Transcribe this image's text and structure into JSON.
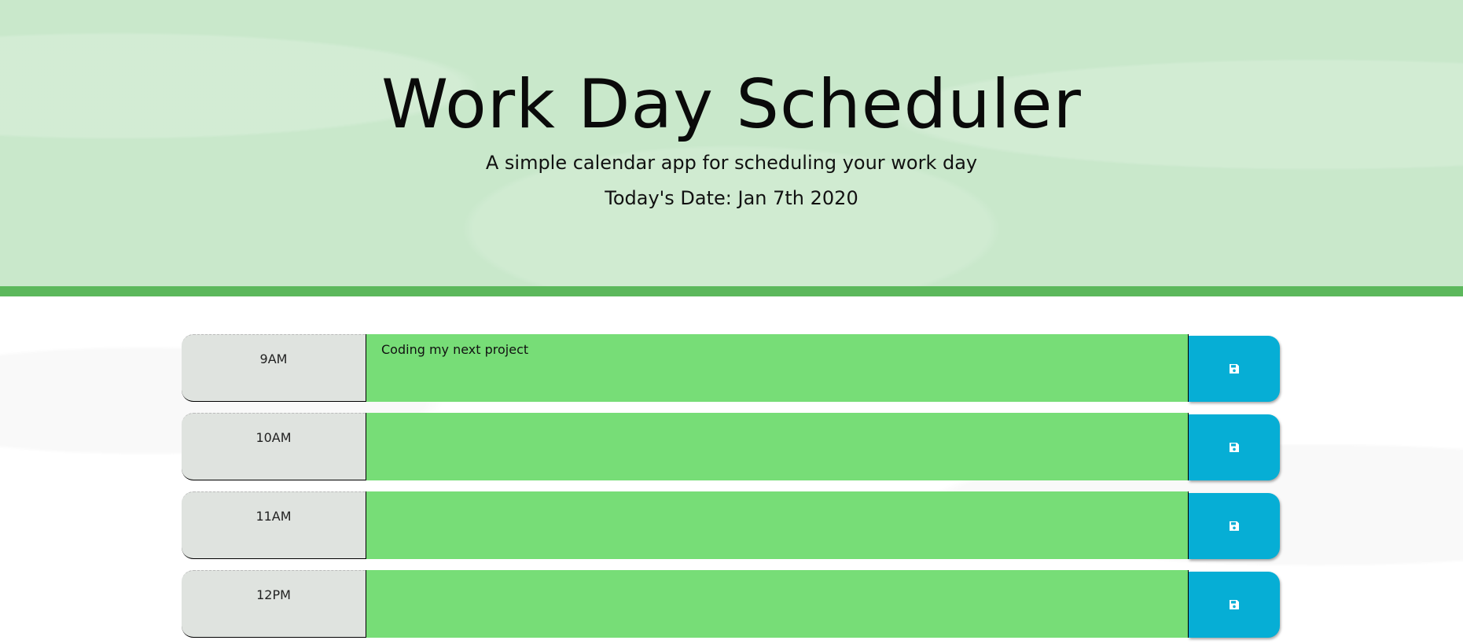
{
  "header": {
    "title": "Work Day Scheduler",
    "subtitle": "A simple calendar app for scheduling your work day",
    "date_label": "Today's Date: Jan 7th 2020"
  },
  "colors": {
    "header_bg": "#c9e8cb",
    "header_border": "#5cb85c",
    "present_future_block": "#77dd77",
    "hour_bg": "#dfe3df",
    "save_button": "#06aed5"
  },
  "time_blocks": [
    {
      "hour": "9AM",
      "description": "Coding my next project",
      "save_icon": "save-icon"
    },
    {
      "hour": "10AM",
      "description": "",
      "save_icon": "save-icon"
    },
    {
      "hour": "11AM",
      "description": "",
      "save_icon": "save-icon"
    },
    {
      "hour": "12PM",
      "description": "",
      "save_icon": "save-icon"
    }
  ]
}
